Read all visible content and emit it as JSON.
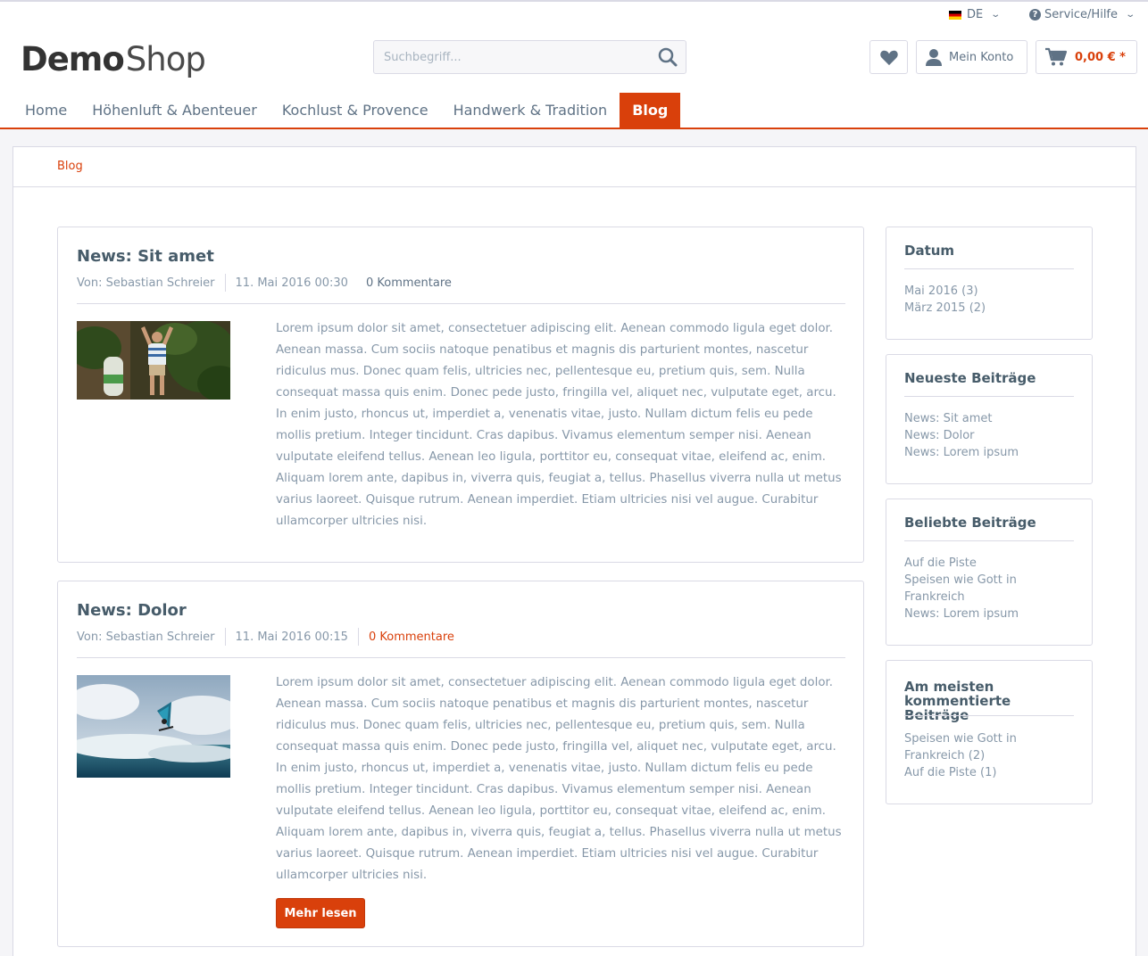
{
  "topbar": {
    "language": "DE",
    "service": "Service/Hilfe"
  },
  "logo": {
    "bold": "Demo",
    "light": "Shop"
  },
  "search": {
    "placeholder": "Suchbegriff..."
  },
  "header_actions": {
    "account_label": "Mein Konto",
    "cart_total": "0,00 € *"
  },
  "nav": {
    "items": [
      "Home",
      "Höhenluft & Abenteuer",
      "Kochlust & Provence",
      "Handwerk & Tradition",
      "Blog"
    ]
  },
  "breadcrumb": {
    "current": "Blog"
  },
  "articles": [
    {
      "title": "News: Sit amet",
      "author": "Von: Sebastian Schreier",
      "date": "11. Mai 2016 00:30",
      "comments": "0 Kommentare",
      "text": "Lorem ipsum dolor sit amet, consectetuer adipiscing elit. Aenean commodo ligula eget dolor. Aenean massa. Cum sociis natoque penatibus et magnis dis parturient montes, nascetur ridiculus mus. Donec quam felis, ultricies nec, pellentesque eu, pretium quis, sem. Nulla consequat massa quis enim. Donec pede justo, fringilla vel, aliquet nec, vulputate eget, arcu. In enim justo, rhoncus ut, imperdiet a, venenatis vitae, justo. Nullam dictum felis eu pede mollis pretium. Integer tincidunt. Cras dapibus. Vivamus elementum semper nisi. Aenean vulputate eleifend tellus. Aenean leo ligula, porttitor eu, consequat vitae, eleifend ac, enim. Aliquam lorem ante, dapibus in, viverra quis, feugiat a, tellus. Phasellus viverra nulla ut metus varius laoreet. Quisque rutrum. Aenean imperdiet. Etiam ultricies nisi vel augue. Curabitur ullamcorper ultricies nisi."
    },
    {
      "title": "News: Dolor",
      "author": "Von: Sebastian Schreier",
      "date": "11. Mai 2016 00:15",
      "comments": "0 Kommentare",
      "text": "Lorem ipsum dolor sit amet, consectetuer adipiscing elit. Aenean commodo ligula eget dolor. Aenean massa. Cum sociis natoque penatibus et magnis dis parturient montes, nascetur ridiculus mus. Donec quam felis, ultricies nec, pellentesque eu, pretium quis, sem. Nulla consequat massa quis enim. Donec pede justo, fringilla vel, aliquet nec, vulputate eget, arcu. In enim justo, rhoncus ut, imperdiet a, venenatis vitae, justo. Nullam dictum felis eu pede mollis pretium. Integer tincidunt. Cras dapibus. Vivamus elementum semper nisi. Aenean vulputate eleifend tellus. Aenean leo ligula, porttitor eu, consequat vitae, eleifend ac, enim. Aliquam lorem ante, dapibus in, viverra quis, feugiat a, tellus. Phasellus viverra nulla ut metus varius laoreet. Quisque rutrum. Aenean imperdiet. Etiam ultricies nisi vel augue. Curabitur ullamcorper ultricies nisi.",
      "button": "Mehr lesen"
    }
  ],
  "sidebar": {
    "datum": {
      "title": "Datum",
      "items": [
        "Mai 2016 (3)",
        "März 2015 (2)"
      ]
    },
    "neueste": {
      "title": "Neueste Beiträge",
      "items": [
        "News: Sit amet",
        "News: Dolor",
        "News: Lorem ipsum"
      ]
    },
    "beliebte": {
      "title": "Beliebte Beiträge",
      "items": [
        "Auf die Piste",
        "Speisen wie Gott in Frankreich",
        "News: Lorem ipsum"
      ]
    },
    "kommentiert": {
      "title": "Am meisten kommentierte Beiträge",
      "items": [
        "Speisen wie Gott in Frankreich (2)",
        "Auf die Piste (1)"
      ]
    }
  },
  "colors": {
    "accent": "#d9400b",
    "text": "#5f7285",
    "muted": "#8798a9",
    "border": "#dadae5"
  }
}
